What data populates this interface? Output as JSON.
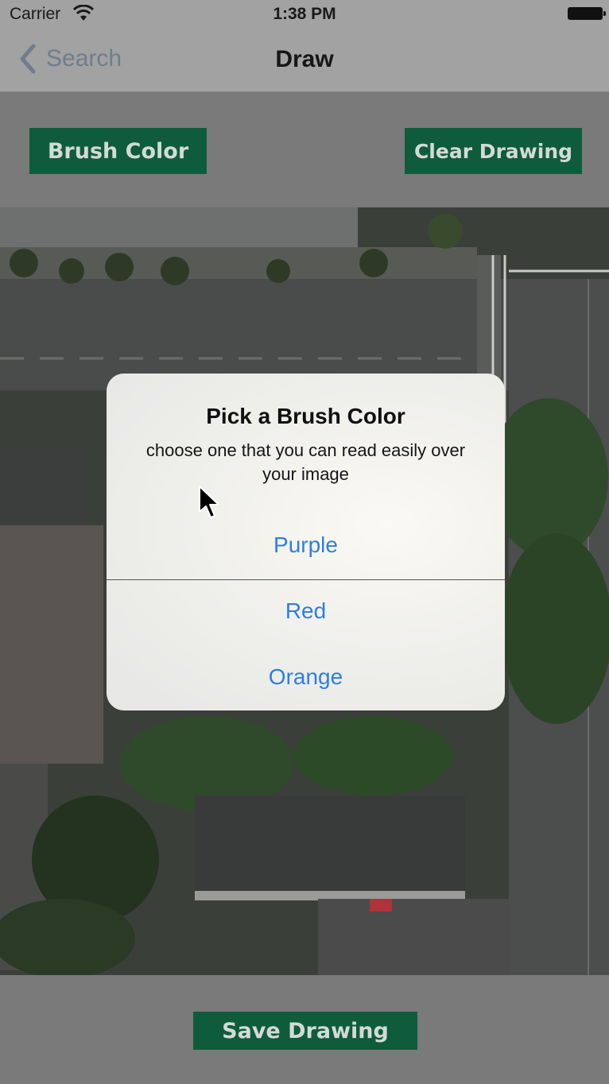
{
  "status_bar": {
    "carrier": "Carrier",
    "time": "1:38 PM",
    "icons": [
      "wifi-icon",
      "battery-icon"
    ]
  },
  "nav_bar": {
    "back_label": "Search",
    "title": "Draw"
  },
  "toolbar": {
    "brush_color_label": "Brush Color",
    "clear_drawing_label": "Clear Drawing"
  },
  "alert": {
    "title": "Pick a Brush Color",
    "message": "choose one that you can read easily over your image",
    "actions": [
      {
        "label": "Purple"
      },
      {
        "label": "Red"
      },
      {
        "label": "Orange"
      }
    ]
  },
  "bottom_bar": {
    "save_drawing_label": "Save Drawing"
  },
  "colors": {
    "button_green": "#0f5c3c",
    "action_blue": "#2f7ee0",
    "nav_gray": "#a2a2a2"
  }
}
